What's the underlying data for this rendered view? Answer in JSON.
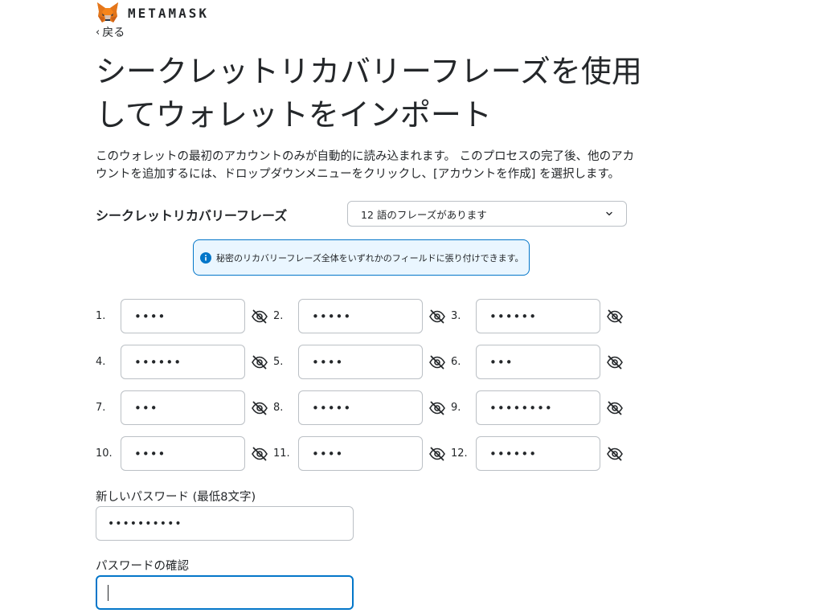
{
  "header": {
    "brand": "METAMASK",
    "back_label": "戻る"
  },
  "title": "シークレットリカバリーフレーズを使用してウォレットをインポート",
  "description": "このウォレットの最初のアカウントのみが自動的に読み込まれます。 このプロセスの完了後、他のアカウントを追加するには、ドロップダウンメニューをクリックし、[アカウントを作成] を選択します。",
  "srp": {
    "label": "シークレットリカバリーフレーズ",
    "select_value": "12 語のフレーズがあります",
    "info_banner": "秘密のリカバリーフレーズ全体をいずれかのフィールドに張り付けできます。",
    "words": [
      {
        "num": "1.",
        "value": "••••"
      },
      {
        "num": "2.",
        "value": "•••••"
      },
      {
        "num": "3.",
        "value": "••••••"
      },
      {
        "num": "4.",
        "value": "••••••"
      },
      {
        "num": "5.",
        "value": "••••"
      },
      {
        "num": "6.",
        "value": "•••"
      },
      {
        "num": "7.",
        "value": "•••"
      },
      {
        "num": "8.",
        "value": "•••••"
      },
      {
        "num": "9.",
        "value": "••••••••"
      },
      {
        "num": "10.",
        "value": "••••"
      },
      {
        "num": "11.",
        "value": "••••"
      },
      {
        "num": "12.",
        "value": "••••••"
      }
    ]
  },
  "password": {
    "new_label": "新しいパスワード (最低8文字)",
    "new_value": "••••••••••",
    "confirm_label": "パスワードの確認",
    "confirm_value": ""
  },
  "colors": {
    "accent": "#0376c9",
    "info_bg": "#eaf6ff",
    "border": "#bbc0c5",
    "text": "#24272a",
    "fox_orange": "#e2761b"
  },
  "icons": {
    "logo": "metamask-fox-icon",
    "back": "chevron-left-icon",
    "select": "chevron-down-icon",
    "info": "info-icon",
    "reveal": "eye-slash-icon"
  }
}
